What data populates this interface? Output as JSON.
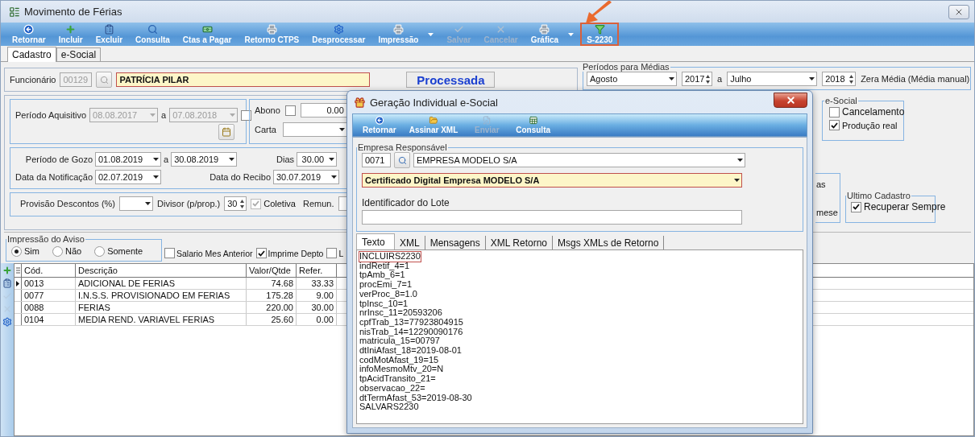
{
  "window": {
    "title": "Movimento de Férias"
  },
  "toolbar": [
    {
      "label": "Retornar",
      "kind": "back",
      "disabled": false,
      "dropdown": false,
      "highlighted": false
    },
    {
      "label": "Incluir",
      "kind": "plus",
      "disabled": false,
      "dropdown": false,
      "highlighted": false
    },
    {
      "label": "Excluir",
      "kind": "clipboard",
      "disabled": false,
      "dropdown": false,
      "highlighted": false
    },
    {
      "label": "Consulta",
      "kind": "search",
      "disabled": false,
      "dropdown": false,
      "highlighted": false
    },
    {
      "label": "Ctas a Pagar",
      "kind": "money",
      "disabled": false,
      "dropdown": false,
      "highlighted": false
    },
    {
      "label": "Retorno CTPS",
      "kind": "printer",
      "disabled": false,
      "dropdown": false,
      "highlighted": false
    },
    {
      "label": "Desprocessar",
      "kind": "gear",
      "disabled": false,
      "dropdown": false,
      "highlighted": false
    },
    {
      "label": "Impressão",
      "kind": "printer",
      "disabled": false,
      "dropdown": true,
      "highlighted": false
    },
    {
      "label": "Salvar",
      "kind": "check",
      "disabled": true,
      "dropdown": false,
      "highlighted": false
    },
    {
      "label": "Cancelar",
      "kind": "cross",
      "disabled": true,
      "dropdown": false,
      "highlighted": false
    },
    {
      "label": "Gráfica",
      "kind": "printer",
      "disabled": false,
      "dropdown": true,
      "highlighted": false
    },
    {
      "label": "S-2230",
      "kind": "funnel",
      "disabled": false,
      "dropdown": false,
      "highlighted": true
    }
  ],
  "tabs": [
    {
      "label": "Cadastro",
      "selected": true
    },
    {
      "label": "e-Social",
      "selected": false
    }
  ],
  "employee": {
    "label": "Funcionário",
    "code": "00129",
    "name": "PATRÍCIA PILAR",
    "status": "Processada"
  },
  "averages": {
    "title": "Períodos para Médias",
    "from_month": "Agosto",
    "from_year": "2017",
    "separator": "a",
    "to_month": "Julho",
    "to_year": "2018",
    "reset_label": "Zera Média (Média manual)"
  },
  "acquisition": {
    "label": "Período Aquisitivo",
    "start": "08.08.2017",
    "separator": "a",
    "end": "07.08.2018",
    "checked": false
  },
  "abono": {
    "label": "Abono",
    "checked": false,
    "value": "0.00",
    "letter_label": "Carta"
  },
  "leave": {
    "label": "Período de Gozo",
    "start": "01.08.2019",
    "separator": "a",
    "end": "30.08.2019",
    "days_label": "Dias",
    "days": "30.00",
    "notice_label": "Data da Notificação",
    "notice": "02.07.2019",
    "receipt_label": "Data do Recibo",
    "receipt": "30.07.2019"
  },
  "provision": {
    "label": "Provisão Descontos (%)",
    "divisor_label": "Divisor (p/prop.)",
    "divisor": "30",
    "collective": {
      "label": "Coletiva",
      "checked": true
    },
    "remun_label": "Remun."
  },
  "esocial": {
    "title": "e-Social",
    "options": [
      {
        "label": "Cancelamento",
        "checked": false
      },
      {
        "label": "Produção real",
        "checked": true
      }
    ]
  },
  "hidden_group": {
    "fragments": [
      "as",
      "mese"
    ]
  },
  "last_record": {
    "title": "Ultimo Cadastro",
    "option": {
      "label": "Recuperar Sempre",
      "checked": true
    }
  },
  "notice_print": {
    "title": "Impressão do Aviso",
    "options": [
      {
        "label": "Sim",
        "selected": true
      },
      {
        "label": "Não",
        "selected": false
      },
      {
        "label": "Somente",
        "selected": false
      }
    ]
  },
  "print_options": [
    {
      "label": "Salario Mes Anterior",
      "checked": false
    },
    {
      "label": "Imprime Depto",
      "checked": true
    },
    {
      "label": "L",
      "checked": false
    }
  ],
  "side_tools": [
    {
      "kind": "plus",
      "disabled": false
    },
    {
      "kind": "clipboard",
      "disabled": false
    },
    {
      "kind": "check",
      "disabled": true
    },
    {
      "kind": "cross",
      "disabled": true
    },
    {
      "kind": "gear",
      "disabled": false
    }
  ],
  "grid": {
    "columns": [
      "Cód.",
      "Descrição",
      "Valor/Qtde",
      "Refer."
    ],
    "rows": [
      {
        "cells": [
          "0013",
          "ADICIONAL DE FERIAS",
          "74.68",
          "33.33"
        ],
        "selected": true
      },
      {
        "cells": [
          "0077",
          "I.N.S.S. PROVISIONADO EM FERIAS",
          "175.28",
          "9.00"
        ],
        "selected": false
      },
      {
        "cells": [
          "0088",
          "FERIAS",
          "220.00",
          "30.00"
        ],
        "selected": false
      },
      {
        "cells": [
          "0104",
          "MEDIA REND. VARIAVEL  FERIAS",
          "25.60",
          "0.00"
        ],
        "selected": false
      }
    ]
  },
  "dialog": {
    "title": "Geração Individual e-Social",
    "toolbar": [
      {
        "label": "Retornar",
        "kind": "back",
        "disabled": false
      },
      {
        "label": "Assinar XML",
        "kind": "folder",
        "disabled": false
      },
      {
        "label": "Enviar",
        "kind": "edit",
        "disabled": true
      },
      {
        "label": "Consulta",
        "kind": "sheet",
        "disabled": false
      }
    ],
    "company": {
      "title": "Empresa Responsável",
      "code": "0071",
      "name": "EMPRESA MODELO S/A",
      "certificate": "Certificado Digital Empresa MODELO S/A",
      "batch_label": "Identificador do Lote"
    },
    "tabs": [
      {
        "label": "Texto",
        "selected": true
      },
      {
        "label": "XML",
        "selected": false
      },
      {
        "label": "Mensagens",
        "selected": false
      },
      {
        "label": "XML Retorno",
        "selected": false
      },
      {
        "label": "Msgs XMLs de Retorno",
        "selected": false
      }
    ],
    "lines": [
      {
        "text": "INCLUIRS2230",
        "highlighted": true
      },
      {
        "text": "indRetif_4=1",
        "highlighted": false
      },
      {
        "text": "tpAmb_6=1",
        "highlighted": false
      },
      {
        "text": "procEmi_7=1",
        "highlighted": false
      },
      {
        "text": "verProc_8=1.0",
        "highlighted": false
      },
      {
        "text": "tpInsc_10=1",
        "highlighted": false
      },
      {
        "text": "nrInsc_11=20593206",
        "highlighted": false
      },
      {
        "text": "cpfTrab_13=77923804915",
        "highlighted": false
      },
      {
        "text": "nisTrab_14=12290090176",
        "highlighted": false
      },
      {
        "text": "matricula_15=00797",
        "highlighted": false
      },
      {
        "text": "dtIniAfast_18=2019-08-01",
        "highlighted": false
      },
      {
        "text": "codMotAfast_19=15",
        "highlighted": false
      },
      {
        "text": "infoMesmoMtv_20=N",
        "highlighted": false
      },
      {
        "text": "tpAcidTransito_21=",
        "highlighted": false
      },
      {
        "text": "observacao_22=",
        "highlighted": false
      },
      {
        "text": "dtTermAfast_53=2019-08-30",
        "highlighted": false
      },
      {
        "text": "SALVARS2230",
        "highlighted": false
      }
    ]
  }
}
